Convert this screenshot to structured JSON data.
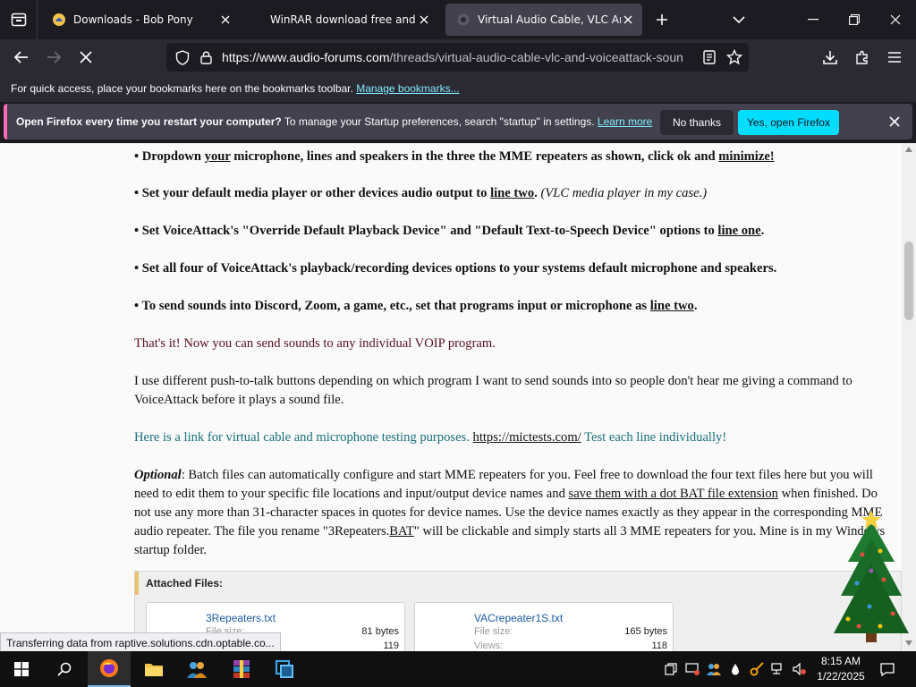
{
  "tabs": [
    {
      "title": "Downloads - Bob Pony",
      "active": false
    },
    {
      "title": "WinRAR download free and sup",
      "active": false
    },
    {
      "title": "Virtual Audio Cable, VLC And V",
      "active": true
    }
  ],
  "url": {
    "host": "https://www.audio-forums.com",
    "path": "/threads/virtual-audio-cable-vlc-and-voiceattack-soun"
  },
  "bookmarks_bar": {
    "text": "For quick access, place your bookmarks here on the bookmarks toolbar.",
    "link": "Manage bookmarks..."
  },
  "notification": {
    "title": "Open Firefox every time you restart your computer?",
    "body": "To manage your Startup preferences, search \"startup\" in settings.",
    "link": "Learn more",
    "no_label": "No thanks",
    "yes_label": "Yes, open Firefox"
  },
  "article": {
    "p1": {
      "a": "• Dropdown ",
      "u1": "your",
      "b": " microphone, lines and speakers in the three the MME repeaters as shown, click ok and ",
      "u2": "minimize!"
    },
    "p2": {
      "a": "• Set your default media player or other devices audio output to ",
      "u": "line two",
      "b": ".",
      "i": "(VLC media player in my case.)"
    },
    "p3": {
      "a": "• Set VoiceAttack's \"Override Default Playback Device\" and \"Default Text-to-Speech Device\" options to ",
      "u": "line one",
      "b": "."
    },
    "p4": "• Set all four of VoiceAttack's playback/recording devices options to your systems default microphone and speakers.",
    "p5": {
      "a": "• To send sounds into Discord, Zoom, a game, etc., set that programs input or microphone as ",
      "u": "line two",
      "b": "."
    },
    "p6": "That's it! Now you can send sounds to any individual VOIP program.",
    "p7": "I use different push-to-talk buttons depending on which program I want to send sounds into so people don't hear me giving a command to VoiceAttack before it plays a sound file.",
    "p8": {
      "a": "Here is a link for virtual cable and microphone testing purposes. ",
      "link": "https://mictests.com/",
      "b": " Test each line individually!"
    },
    "p9": {
      "label": "Optional",
      "a": ": Batch files can automatically configure and start MME repeaters for you. Feel free to download the four text files here but you will need to edit them to your specific file locations and input/output device names and ",
      "u": "save them with a dot BAT file extension",
      "b": " when finished. Do not use any more than 31-character spaces in quotes for device names. Use the device names exactly as they appear in the corresponding MME audio repeater. The file you rename \"3Repeaters.",
      "u2": "BAT",
      "c": "\" will be clickable and simply starts all 3 MME repeaters for you. Mine is in my Windows startup folder."
    }
  },
  "attached": {
    "header": "Attached Files:",
    "files": [
      {
        "name": "3Repeaters.txt",
        "size_label": "File size:",
        "size": "81 bytes",
        "views": "119"
      },
      {
        "name": "VACrepeater1S.txt",
        "size_label": "File size:",
        "size": "165 bytes",
        "views_label": "Views:",
        "views": "118"
      }
    ]
  },
  "status_text": "Transferring data from raptive.solutions.cdn.optable.co...",
  "clock": {
    "time": "8:15 AM",
    "date": "1/22/2025"
  },
  "colors": {
    "accent": "#00ddff",
    "notif_stripe": "#ff6bba",
    "link_cyan": "#80ebff"
  }
}
